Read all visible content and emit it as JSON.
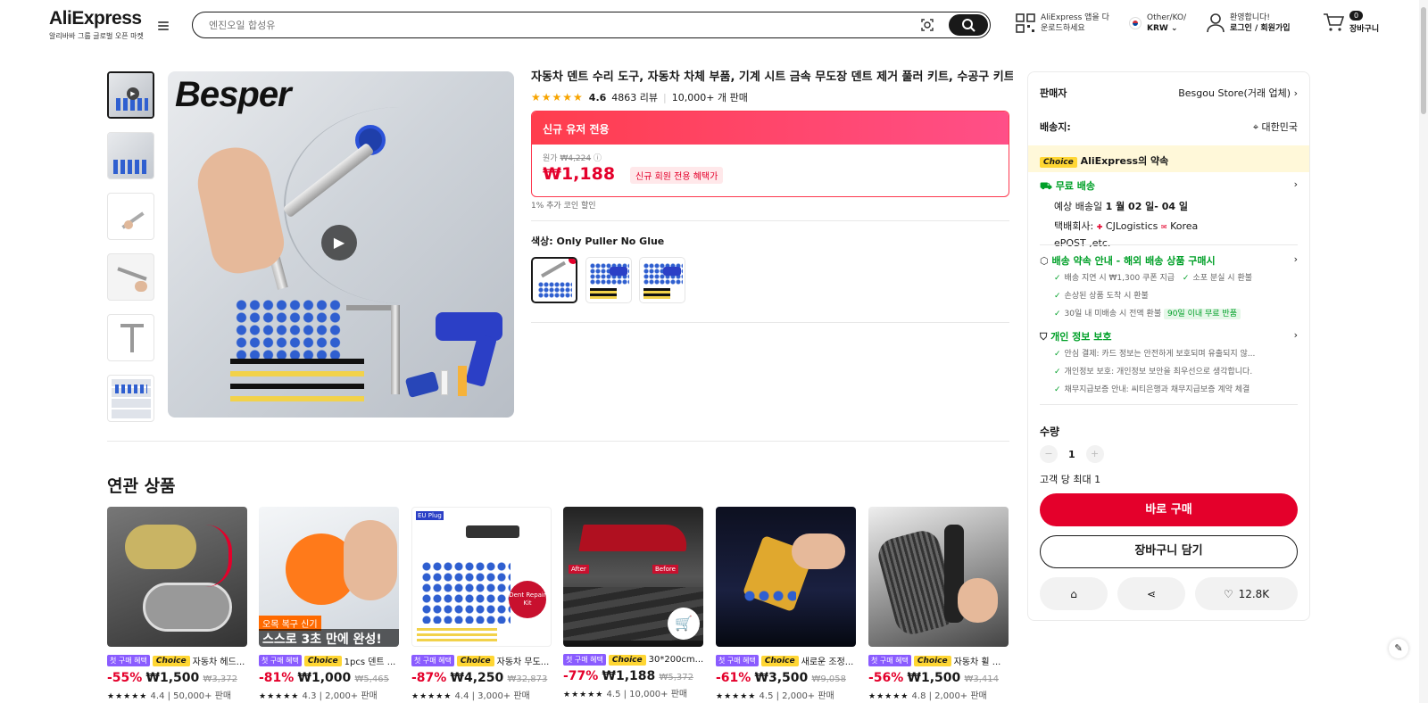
{
  "header": {
    "logo": "AliExpress",
    "logo_sub": "알리바바 그룹 글로벌 오픈 마켓",
    "search_placeholder": "엔진오일 합성유",
    "app_line1": "AliExpress 앱을 다",
    "app_line2": "운로드하세요",
    "region_line1": "Other/KO/",
    "region_line2": "KRW",
    "account_line1": "환영합니다!",
    "account_line2": "로그인 / 회원가입",
    "cart_count": "0",
    "cart_label": "장바구니"
  },
  "product": {
    "title": "자동차 덴트 수리 도구, 자동차 차체 부품, 기계 시트 금속 무도장 덴트 제거 풀러 키트, 수공구 키트 세트",
    "rating": "4.6",
    "reviews": "4863 리뷰",
    "sold": "10,000+ 개 판매",
    "main_image_brand": "Besper",
    "promo_banner": "신규 유저 전용",
    "original_label": "원가",
    "original_price": "₩4,224",
    "price": "₩1,188",
    "promo_tag": "신규 회원 전용 혜택가",
    "coin_note": "1% 추가 코인 할인",
    "color_label": "색상: Only Puller No Glue"
  },
  "panel": {
    "seller_label": "판매자",
    "seller_value": "Besgou Store(거래 업체)",
    "ship_label": "배송지:",
    "ship_value": "대한민국",
    "choice_badge": "Choice",
    "choice_text": "AliExpress의 약속",
    "free_ship": "무료 배송",
    "eta_prefix": "예상 배송일",
    "eta_value": "1 월 02 일- 04 일",
    "carrier_label": "택배회사:",
    "carrier1": "CJLogistics",
    "carrier2": "Korea",
    "carrier3": "ePOST ,etc.",
    "promise_title": "배송 약속 안내 - 해외 배송 상품 구매시",
    "promise1": "배송 지연 시 ₩1,300 쿠폰 지급",
    "promise2": "소포 분실 시 환불",
    "promise3": "손상된 상품 도착 시 환불",
    "promise4": "30일 내 미배송 시 전액 환불",
    "promise4_tag": "90일 이내 무료 반품",
    "privacy_title": "개인 정보 보호",
    "privacy1": "안심 결제: 카드 정보는 안전하게 보호되며 유출되지 않...",
    "privacy2": "개인정보 보호: 개인정보 보안을 최우선으로 생각합니다.",
    "privacy3": "채무지급보증 안내: 씨티은행과 채무지급보증 계약 체결",
    "qty_label": "수량",
    "qty_value": "1",
    "qty_limit": "고객 당 최대 1",
    "buy_now": "바로 구매",
    "add_cart": "장바구니 담기",
    "wishlist_count": "12.8K"
  },
  "related": {
    "title": "연관 상품",
    "first_badge": "첫 구매 혜택",
    "choice_badge": "Choice",
    "items": [
      {
        "name": "자동차 헤드...",
        "discount": "-55%",
        "price": "₩1,500",
        "orig": "₩3,372",
        "rating": "4.4",
        "sold": "50,000+ 판매"
      },
      {
        "name": "1pcs 덴트 ...",
        "discount": "-81%",
        "price": "₩1,000",
        "orig": "₩5,465",
        "rating": "4.3",
        "sold": "2,000+ 판매",
        "overlay1": "오목 복구 신기",
        "overlay2": "스스로 3초 만에 완성!"
      },
      {
        "name": "자동차 무도...",
        "discount": "-87%",
        "price": "₩4,250",
        "orig": "₩32,873",
        "rating": "4.4",
        "sold": "3,000+ 판매",
        "overlay1": "EU Plug",
        "overlay2": "Dent Repair Kit"
      },
      {
        "name": "30*200cm...",
        "discount": "-77%",
        "price": "₩1,188",
        "orig": "₩5,372",
        "rating": "4.5",
        "sold": "10,000+ 판매",
        "overlay1": "After",
        "overlay2": "Before"
      },
      {
        "name": "새로운 조정...",
        "discount": "-61%",
        "price": "₩3,500",
        "orig": "₩9,058",
        "rating": "4.5",
        "sold": "2,000+ 판매"
      },
      {
        "name": "자동차 휠 ...",
        "discount": "-56%",
        "price": "₩1,500",
        "orig": "₩3,414",
        "rating": "4.8",
        "sold": "2,000+ 판매"
      }
    ]
  }
}
